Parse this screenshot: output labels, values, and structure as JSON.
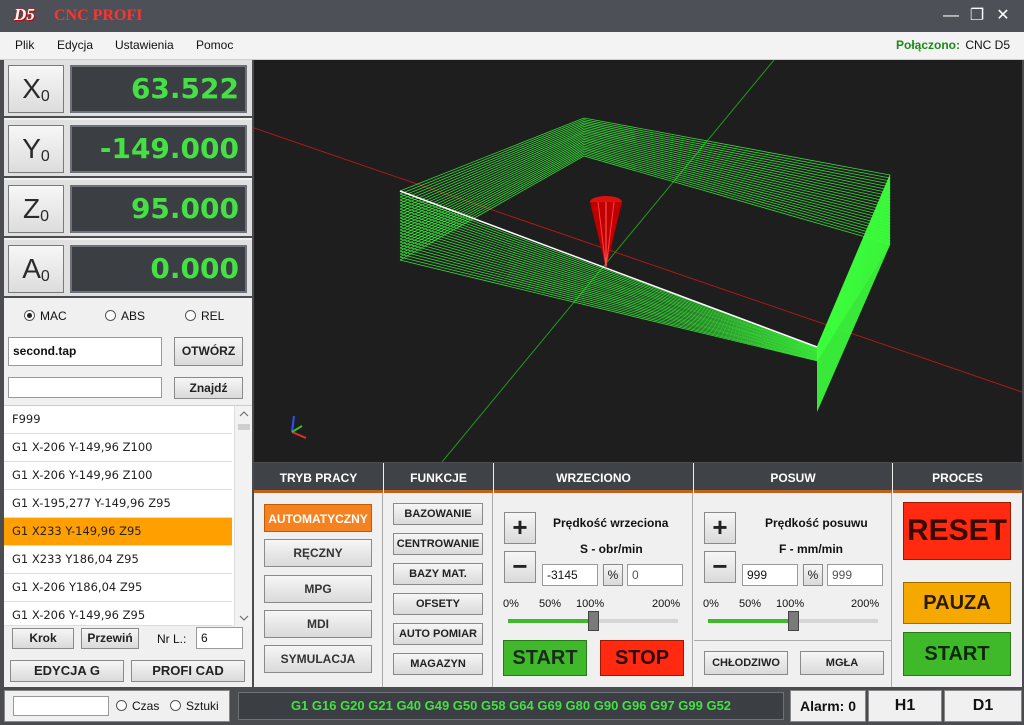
{
  "app": {
    "logo": "D5",
    "title": "CNC PROFI"
  },
  "window": {
    "minimize": "—",
    "maximize": "❐",
    "close": "✕"
  },
  "menu": [
    "Plik",
    "Edycja",
    "Ustawienia",
    "Pomoc"
  ],
  "connection": {
    "label": "Połączono:",
    "value": "CNC D5"
  },
  "axes": [
    {
      "name": "X",
      "sub": "0",
      "value": "63.522"
    },
    {
      "name": "Y",
      "sub": "0",
      "value": "-149.000"
    },
    {
      "name": "Z",
      "sub": "0",
      "value": "95.000"
    },
    {
      "name": "A",
      "sub": "0",
      "value": "0.000"
    }
  ],
  "coord_modes": {
    "options": [
      "MAC",
      "ABS",
      "REL"
    ],
    "selected": "MAC"
  },
  "file": {
    "name": "second.tap",
    "open_label": "OTWÓRZ",
    "search_value": "",
    "find_label": "Znajdź"
  },
  "program_lines": [
    "F999",
    "G1 X-206 Y-149,96 Z100",
    "G1 X-206 Y-149,96 Z100",
    "G1 X-195,277 Y-149,96 Z95",
    "G1 X233 Y-149,96 Z95",
    "G1 X233 Y186,04 Z95",
    "G1 X-206 Y186,04 Z95",
    "G1 X-206 Y-149,96 Z95"
  ],
  "selected_line_index": 4,
  "step": {
    "krok": "Krok",
    "przewin": "Przewiń",
    "nr_label": "Nr L.:",
    "nr_value": "6"
  },
  "edit": {
    "edycja": "EDYCJA G",
    "profi_cad": "PROFI CAD"
  },
  "sections": {
    "tryb": {
      "title": "TRYB PRACY",
      "buttons": [
        "AUTOMATYCZNY",
        "RĘCZNY",
        "MPG",
        "MDI",
        "SYMULACJA"
      ],
      "active": "AUTOMATYCZNY"
    },
    "funkcje": {
      "title": "FUNKCJE",
      "buttons": [
        "BAZOWANIE",
        "CENTROWANIE",
        "BAZY MAT.",
        "OFSETY",
        "AUTO POMIAR",
        "MAGAZYN"
      ]
    },
    "wrzeciono": {
      "title": "WRZECIONO",
      "label": "Prędkość wrzeciona",
      "unit": "S - obr/min",
      "value": "-3145",
      "pct_symbol": "%",
      "value2": "0",
      "ticks": [
        "0%",
        "50%",
        "100%",
        "200%"
      ],
      "slider_fraction": 0.5,
      "start": "START",
      "stop": "STOP",
      "plus": "+",
      "minus": "−"
    },
    "posuw": {
      "title": "POSUW",
      "label": "Prędkość posuwu",
      "unit": "F - mm/min",
      "value": "999",
      "pct_symbol": "%",
      "value2": "999",
      "ticks": [
        "0%",
        "50%",
        "100%",
        "200%"
      ],
      "slider_fraction": 0.5,
      "chlodziwo": "CHŁODZIWO",
      "mgla": "MGŁA",
      "plus": "+",
      "minus": "−"
    },
    "proces": {
      "title": "PROCES",
      "reset": "RESET",
      "pauza": "PAUZA",
      "start": "START"
    }
  },
  "status": {
    "time_value": "",
    "czas": "Czas",
    "sztuki": "Sztuki",
    "gcodes": "G1 G16 G20 G21 G40 G49 G50 G58 G64 G69 G80 G90 G96 G97 G99 G52",
    "alarm": "Alarm: 0",
    "h": "H1",
    "d": "D1"
  },
  "colors": {
    "accent": "#f58220",
    "readout": "#44e044",
    "toolpath": "#3cff3c",
    "reset": "#ff2a10",
    "pauza": "#f5a800",
    "start": "#3fb82a",
    "stop": "#ff2a10"
  }
}
